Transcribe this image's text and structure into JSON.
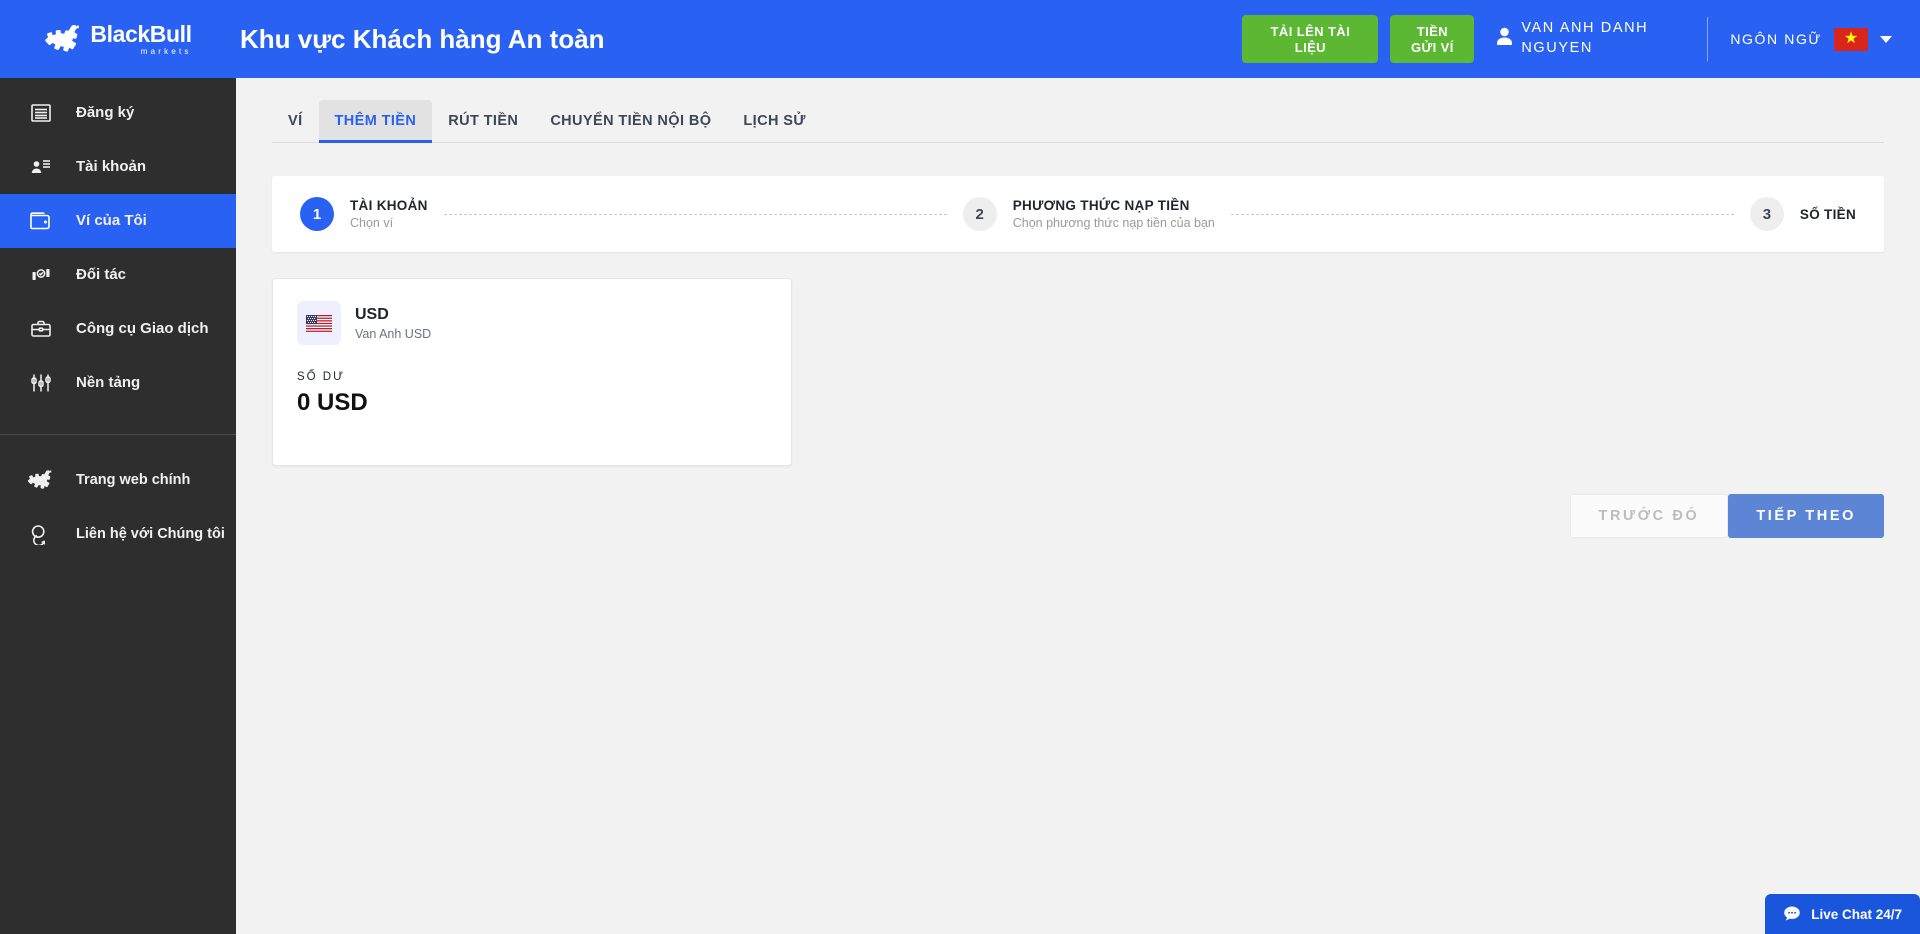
{
  "brand": {
    "logo_main": "BlackBull",
    "logo_sub": "markets",
    "logo_icon": "bull-icon",
    "accent_blue": "#2962f3",
    "accent_green": "#5cb733",
    "sidebar_bg": "#2e2e2e"
  },
  "header": {
    "title": "Khu vực Khách hàng An toàn",
    "upload_button": "TẢI LÊN TÀI LIỆU",
    "deposit_button": "TIỀN GỬI VÍ",
    "user_name": "VAN ANH DANH NGUYEN",
    "user_icon": "person-icon",
    "language_label": "NGÔN NGỮ",
    "language_flag": "vietnam-flag-icon",
    "language_caret": "chevron-down-icon"
  },
  "sidebar": {
    "items": [
      {
        "label": "Đăng ký",
        "icon": "document-lines-icon",
        "active": false
      },
      {
        "label": "Tài khoản",
        "icon": "person-list-icon",
        "active": false
      },
      {
        "label": "Ví của Tôi",
        "icon": "wallet-icon",
        "active": true
      },
      {
        "label": "Đối tác",
        "icon": "partner-handshake-icon",
        "active": false
      },
      {
        "label": "Công cụ Giao dịch",
        "icon": "briefcase-icon",
        "active": false
      },
      {
        "label": "Nền tảng",
        "icon": "candlestick-sliders-icon",
        "active": false
      }
    ],
    "footer_items": [
      {
        "label": "Trang web chính",
        "icon": "bull-icon",
        "active": false
      },
      {
        "label": "Liên hệ với Chúng tôi",
        "icon": "chat-bubbles-icon",
        "active": false
      }
    ]
  },
  "tabs": [
    {
      "label": "VÍ",
      "active": false
    },
    {
      "label": "THÊM TIỀN",
      "active": true
    },
    {
      "label": "RÚT TIỀN",
      "active": false
    },
    {
      "label": "CHUYỂN TIỀN NỘI BỘ",
      "active": false
    },
    {
      "label": "LỊCH SỬ",
      "active": false
    }
  ],
  "stepper": [
    {
      "number": "1",
      "title": "TÀI KHOẢN",
      "subtitle": "Chọn ví",
      "state": "on"
    },
    {
      "number": "2",
      "title": "PHƯƠNG THỨC NẠP TIỀN",
      "subtitle": "Chọn phương thức nạp tiền của bạn",
      "state": "off"
    },
    {
      "number": "3",
      "title": "SỐ TIỀN",
      "subtitle": "",
      "state": "off"
    }
  ],
  "wallet": {
    "flag_icon": "us-flag-icon",
    "currency": "USD",
    "owner": "Van Anh USD",
    "balance_label": "SỐ DƯ",
    "balance_value": "0 USD"
  },
  "actions": {
    "prev_label": "TRƯỚC ĐÓ",
    "next_label": "TIẾP THEO"
  },
  "chat": {
    "label": "Live Chat 24/7",
    "icon": "chat-bubble-icon"
  }
}
